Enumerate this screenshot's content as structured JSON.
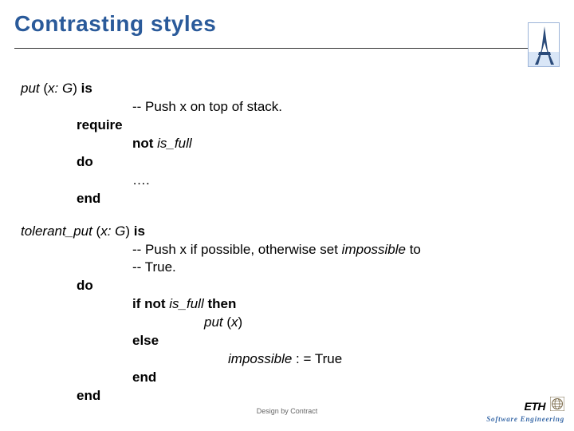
{
  "title": "Contrasting styles",
  "put": {
    "sig_name": "put ",
    "sig_open": "(",
    "sig_param": "x",
    "sig_colon_type": ": G",
    "sig_close_is": ") ",
    "kw_is": "is",
    "comment": "-- Push x on top of stack.",
    "kw_require": "require",
    "precond_not": "not ",
    "precond_pred": "is_full",
    "kw_do": "do",
    "body_dots": "….",
    "kw_end": "end"
  },
  "tput": {
    "sig_name": "tolerant_put ",
    "sig_open": "(",
    "sig_param": "x",
    "sig_colon_type": ": G",
    "sig_close_is": ") ",
    "kw_is": "is",
    "comment1": "-- Push x if possible, otherwise set ",
    "comment1_imp": "impossible",
    "comment1_to": " to",
    "comment2": "-- True.",
    "kw_do": "do",
    "if_kw": "if ",
    "if_not": "not ",
    "if_pred": "is_full",
    "if_then": " then",
    "put_call_name": "put ",
    "put_call_open": "(",
    "put_call_arg": "x",
    "put_call_close": ")",
    "kw_else": "else",
    "imp_var": "impossible",
    "imp_assign": " : = True",
    "kw_end_if": "end",
    "kw_end": "end"
  },
  "footer_center": "Design by Contract",
  "footer_eth": "ETH",
  "footer_se": "Software Engineering"
}
